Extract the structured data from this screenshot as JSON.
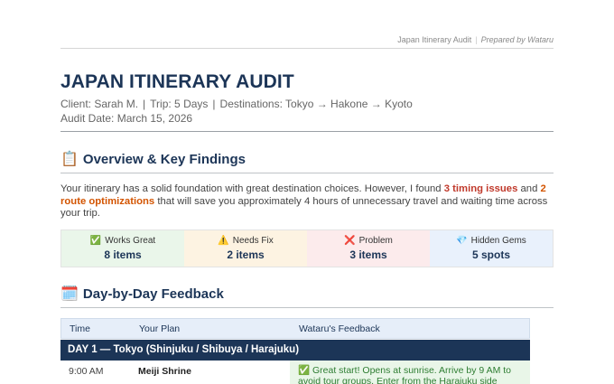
{
  "running_header": {
    "left": "Japan Itinerary Audit",
    "separator": "|",
    "right": "Prepared by Wataru"
  },
  "title": "JAPAN ITINERARY AUDIT",
  "meta": {
    "client": "Client: Sarah M.",
    "trip": "Trip: 5 Days",
    "destinations": "Destinations: Tokyo → Hakone → Kyoto",
    "separator": "|",
    "audit_date": "Audit Date: March 15, 2026"
  },
  "overview": {
    "icon": "📋",
    "heading": "Overview & Key Findings",
    "text_1": "Your itinerary has a solid foundation with great destination choices. However, I found ",
    "highlight_1": "3 timing issues",
    "text_2": " and ",
    "highlight_2": "2 route optimizations",
    "text_3": " that will save you approximately 4 hours of unnecessary travel and waiting time across your trip."
  },
  "stats": [
    {
      "icon": "✅",
      "label": "Works Great",
      "value": "8 items",
      "color": "#eaf6ea"
    },
    {
      "icon": "⚠️",
      "label": "Needs Fix",
      "value": "2 items",
      "color": "#fdf3e2"
    },
    {
      "icon": "❌",
      "label": "Problem",
      "value": "3 items",
      "color": "#fcebec"
    },
    {
      "icon": "💎",
      "label": "Hidden Gems",
      "value": "5 spots",
      "color": "#e9f1fc"
    }
  ],
  "daybyday": {
    "icon": "🗓️",
    "heading": "Day-by-Day Feedback",
    "columns": [
      "Time",
      "Your Plan",
      "Wataru's Feedback"
    ],
    "day_title": "DAY 1 — Tokyo (Shinjuku / Shibuya / Harajuku)",
    "rows": [
      {
        "time": "9:00 AM",
        "plan": "Meiji Shrine",
        "feedback": "✅ Great start! Opens at sunrise. Arrive by 9 AM to avoid tour groups. Enter from the Harajuku side"
      }
    ]
  },
  "colors": {
    "navy": "#1c3557",
    "red_highlight": "#c0392b",
    "orange_highlight": "#d35400",
    "feedback_green": "#2e7d32"
  }
}
